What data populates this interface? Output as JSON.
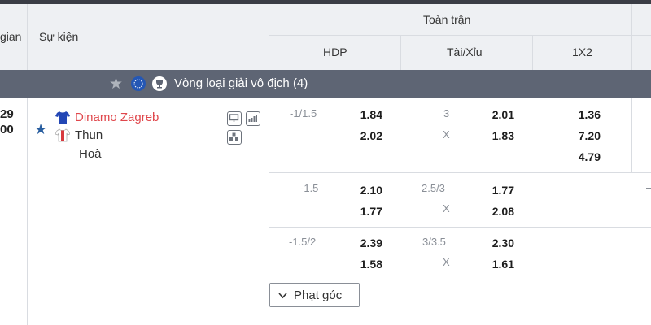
{
  "header": {
    "time_col": "gian",
    "event_col": "Sự kiện",
    "full_match": "Toàn trận",
    "hdp": "HDP",
    "over_under": "Tài/Xỉu",
    "x12": "1X2"
  },
  "league": {
    "name": "Vòng loại giải vô địch",
    "count": "(4)",
    "star_icon": "star-icon",
    "badge_icon": "uefa-badge-icon"
  },
  "match": {
    "time_top": "29",
    "time_bottom": "00",
    "home": "Dinamo Zagreb",
    "away": "Thun",
    "draw": "Hoà"
  },
  "odds_rows": [
    {
      "hdp_line": "-1/1.5",
      "hdp_home": "1.84",
      "hdp_away": "2.02",
      "ou_line": "3",
      "ou_x": "X",
      "ou_over": "2.01",
      "ou_under": "1.83",
      "x12_home": "1.36",
      "x12_draw": "7.20",
      "x12_away": "4.79"
    },
    {
      "hdp_line": "-1.5",
      "hdp_home": "2.10",
      "hdp_away": "1.77",
      "ou_line": "2.5/3",
      "ou_x": "X",
      "ou_over": "1.77",
      "ou_under": "2.08"
    },
    {
      "hdp_line": "-1.5/2",
      "hdp_home": "2.39",
      "hdp_away": "1.58",
      "ou_line": "3/3.5",
      "ou_x": "X",
      "ou_over": "2.30",
      "ou_under": "1.61"
    }
  ],
  "corner_button": "Phạt góc",
  "colors": {
    "home_team": "#e0474c",
    "league_bar": "#5e6574",
    "header_bg": "#eef0f3",
    "star_blue": "#2a5fa0"
  }
}
